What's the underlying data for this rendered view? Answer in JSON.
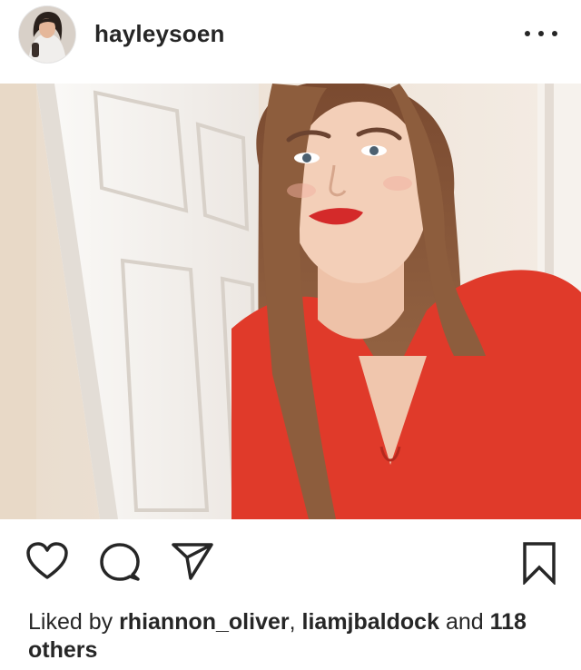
{
  "post": {
    "username": "hayleysoen",
    "more_icon": "more-horizontal-icon",
    "photo": {
      "subject": "selfie of a young woman in a red top",
      "colors": {
        "top": "#e03a2a",
        "hair": "#8a5a3c",
        "skin": "#f1cdb5",
        "wall": "#f3ece4",
        "door": "#f8f6f3"
      }
    },
    "actions": {
      "like_icon": "heart-icon",
      "comment_icon": "comment-icon",
      "share_icon": "send-icon",
      "save_icon": "bookmark-icon"
    },
    "likes": {
      "prefix": "Liked by",
      "user1": "rhiannon_oliver",
      "separator": ",",
      "user2": "liamjbaldock",
      "joiner": "and",
      "others": "118 others"
    }
  }
}
